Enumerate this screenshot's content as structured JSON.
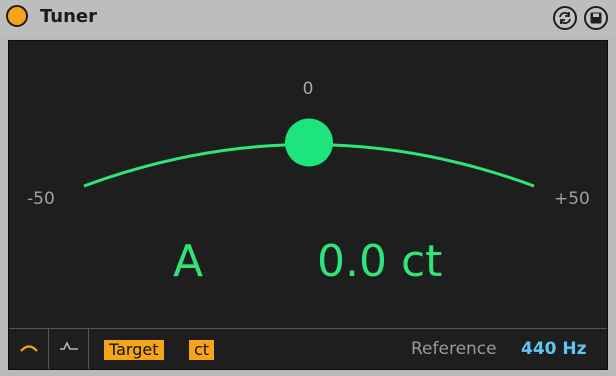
{
  "device": {
    "title": "Tuner",
    "power_color": "#f6a518"
  },
  "meter": {
    "center_label": "0",
    "min_label": "-50",
    "max_label": "+50",
    "deviation_cents": 0.0,
    "arc_color": "#2ee57a"
  },
  "readout": {
    "note": "A",
    "cents": "0.0 ct"
  },
  "bottom": {
    "mode_needle_icon": "arc-needle-icon",
    "mode_histogram_icon": "histogram-icon",
    "target_label": "Target",
    "unit_label": "ct",
    "reference_label": "Reference",
    "reference_value": "440 Hz"
  },
  "header_icons": [
    "hot-swap-icon",
    "save-icon"
  ]
}
